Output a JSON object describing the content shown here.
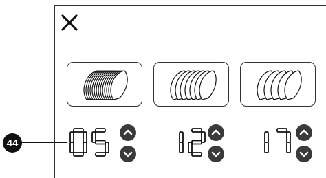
{
  "callout": {
    "number": "44"
  },
  "toolbar": {
    "close_icon": "close-icon"
  },
  "modes": [
    {
      "icon": "bread-slices-icon-dense",
      "selected": false
    },
    {
      "icon": "bread-slices-icon-medium",
      "selected": false
    },
    {
      "icon": "bread-slices-icon-thick",
      "selected": false
    }
  ],
  "settings": [
    {
      "value": "05",
      "up_icon": "chevron-up-icon",
      "down_icon": "chevron-down-icon"
    },
    {
      "value": "12",
      "up_icon": "chevron-up-icon",
      "down_icon": "chevron-down-icon"
    },
    {
      "value": "17",
      "up_icon": "chevron-up-icon",
      "down_icon": "chevron-down-icon"
    }
  ],
  "colors": {
    "stroke": "#333333",
    "button_fill": "#3a3a3a",
    "callout_fill": "#111111"
  }
}
